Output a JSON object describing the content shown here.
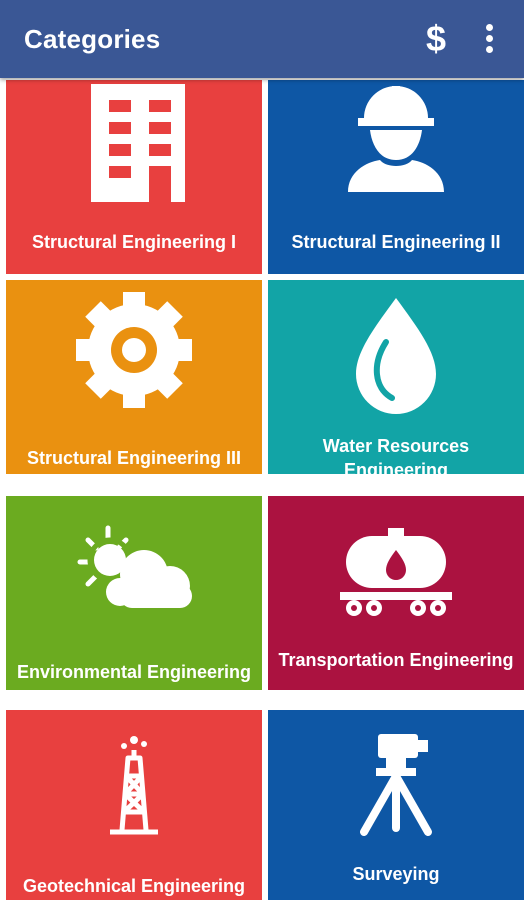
{
  "appbar": {
    "title": "Categories",
    "dollar_glyph": "$",
    "dollar_icon": "dollar-icon",
    "more_icon": "more-vertical-icon"
  },
  "categories": [
    {
      "label": "Structural Engineering I",
      "color": "#e8403f",
      "icon": "building-icon"
    },
    {
      "label": "Structural Engineering II",
      "color": "#0e57a5",
      "icon": "worker-hardhat-icon"
    },
    {
      "label": "Structural Engineering III",
      "color": "#ea9110",
      "icon": "gear-icon"
    },
    {
      "label": "Water Resources Engineering",
      "color": "#12a4a6",
      "icon": "water-drop-icon"
    },
    {
      "label": "Environmental Engineering",
      "color": "#6bab20",
      "icon": "sun-cloud-icon"
    },
    {
      "label": "Transportation Engineering",
      "color": "#ab1240",
      "icon": "tanker-car-icon"
    },
    {
      "label": "Geotechnical Engineering",
      "color": "#e8403f",
      "icon": "drilling-rig-icon"
    },
    {
      "label": "Surveying",
      "color": "#0e57a5",
      "icon": "surveying-tripod-icon"
    }
  ]
}
